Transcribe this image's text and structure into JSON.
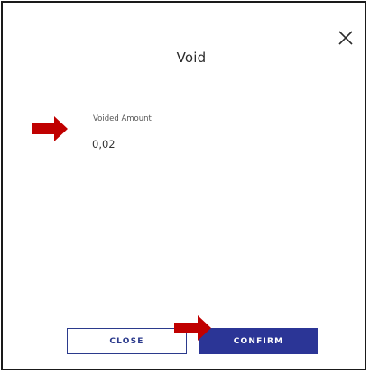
{
  "dialog": {
    "title": "Void",
    "close_icon": "close-icon",
    "field": {
      "label": "Voided Amount",
      "value": "0,02"
    },
    "buttons": {
      "close_label": "CLOSE",
      "confirm_label": "CONFIRM"
    }
  },
  "colors": {
    "primary": "#2b3596",
    "annotation_arrow": "#c00000"
  }
}
